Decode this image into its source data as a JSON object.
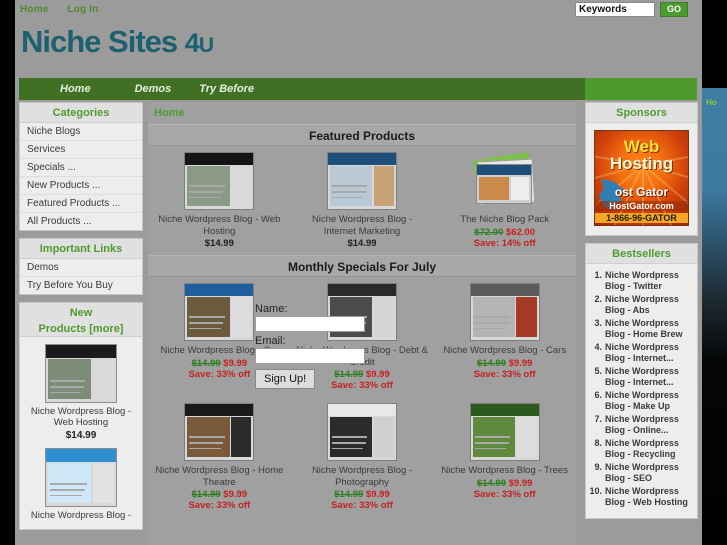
{
  "topbar": {
    "links": [
      {
        "label": "Home"
      },
      {
        "label": "Log In"
      }
    ],
    "search": {
      "value": "Keywords",
      "placeholder": "Keywords",
      "button_label": "GO"
    }
  },
  "logo": {
    "part1": "Niche",
    "part2": "Sites",
    "part3": "4",
    "part4": "U"
  },
  "nav": {
    "items": [
      {
        "label": "Home"
      },
      {
        "label": "Demos"
      },
      {
        "label": "Try Before"
      }
    ]
  },
  "left_sidebar": {
    "categories": {
      "title": "Categories",
      "items": [
        {
          "label": "Niche Blogs"
        },
        {
          "label": "Services"
        },
        {
          "label": "Specials ..."
        },
        {
          "label": "New Products ..."
        },
        {
          "label": "Featured Products ..."
        },
        {
          "label": "All Products ..."
        }
      ]
    },
    "important_links": {
      "title": "Important Links",
      "items": [
        {
          "label": "Demos"
        },
        {
          "label": "Try Before You Buy"
        }
      ]
    },
    "new_products": {
      "title_line1": "New",
      "title_line2": "Products",
      "more_label": "[more]",
      "items": [
        {
          "name": "Niche Wordpress Blog - Web Hosting",
          "price": "$14.99"
        },
        {
          "name": "Niche Wordpress Blog -",
          "price": ""
        }
      ]
    }
  },
  "main": {
    "breadcrumb": "Home",
    "featured": {
      "heading": "Featured Products",
      "products": [
        {
          "name": "Niche Wordpress Blog - Web Hosting",
          "price": "$14.99",
          "old_price": "",
          "new_price": "",
          "save": ""
        },
        {
          "name": "Niche Wordpress Blog - Internet Marketing",
          "price": "$14.99",
          "old_price": "",
          "new_price": "",
          "save": ""
        },
        {
          "name": "The Niche Blog Pack",
          "price": "",
          "old_price": "$72.00",
          "new_price": "$62.00",
          "save": "Save: 14% off"
        }
      ]
    },
    "specials": {
      "heading": "Monthly Specials For July",
      "row1": [
        {
          "name": "Niche Wordpress Blog - C...",
          "old_price": "$14.99",
          "new_price": "$9.99",
          "save": "Save: 33% off"
        },
        {
          "name": "Niche Wordpress Blog - Debt & Credit",
          "old_price": "$14.99",
          "new_price": "$9.99",
          "save": "Save: 33% off"
        },
        {
          "name": "Niche Wordpress Blog - Cars",
          "old_price": "$14.99",
          "new_price": "$9.99",
          "save": "Save: 33% off"
        }
      ],
      "row2": [
        {
          "name": "Niche Wordpress Blog - Home Theatre",
          "old_price": "$14.99",
          "new_price": "$9.99",
          "save": "Save: 33% off"
        },
        {
          "name": "Niche Wordpress Blog - Photography",
          "old_price": "$14.99",
          "new_price": "$9.99",
          "save": "Save: 33% off"
        },
        {
          "name": "Niche Wordpress Blog - Trees",
          "old_price": "$14.99",
          "new_price": "$9.99",
          "save": "Save: 33% off"
        }
      ]
    }
  },
  "right_sidebar": {
    "sponsors": {
      "title": "Sponsors",
      "ad": {
        "line1": "Web",
        "line2": "Hosting",
        "brand": "ost Gator",
        "url": "HostGator.com",
        "phone": "1-866-96-GATOR"
      }
    },
    "bestsellers": {
      "title": "Bestsellers",
      "items": [
        {
          "rank": "1.",
          "label": "Niche Wordpress Blog - Twitter"
        },
        {
          "rank": "2.",
          "label": "Niche Wordpress Blog - Abs"
        },
        {
          "rank": "3.",
          "label": "Niche Wordpress Blog - Home Brew"
        },
        {
          "rank": "4.",
          "label": "Niche Wordpress Blog - Internet..."
        },
        {
          "rank": "5.",
          "label": "Niche Wordpress Blog - Internet..."
        },
        {
          "rank": "6.",
          "label": "Niche Wordpress Blog - Make Up"
        },
        {
          "rank": "7.",
          "label": "Niche Wordpress Blog - Online..."
        },
        {
          "rank": "8.",
          "label": "Niche Wordpress Blog - Recycling"
        },
        {
          "rank": "9.",
          "label": "Niche Wordpress Blog - SEO"
        },
        {
          "rank": "10.",
          "label": "Niche Wordpress Blog - Web Hosting"
        }
      ]
    }
  },
  "newsletter_modal": {
    "name_label": "Name:",
    "name_value": "",
    "email_label": "Email:",
    "email_value": "",
    "submit_label": "Sign Up!"
  },
  "background_window": {
    "label": "Ho"
  },
  "colors": {
    "accent_green": "#4e9b2d",
    "nav_green": "#3f7023",
    "nav_green_light": "#4d9b2f",
    "logo_teal": "#1d6170",
    "price_old": "#2f7f1f",
    "price_new": "#c62020",
    "page_bg": "#9b9b9b"
  }
}
